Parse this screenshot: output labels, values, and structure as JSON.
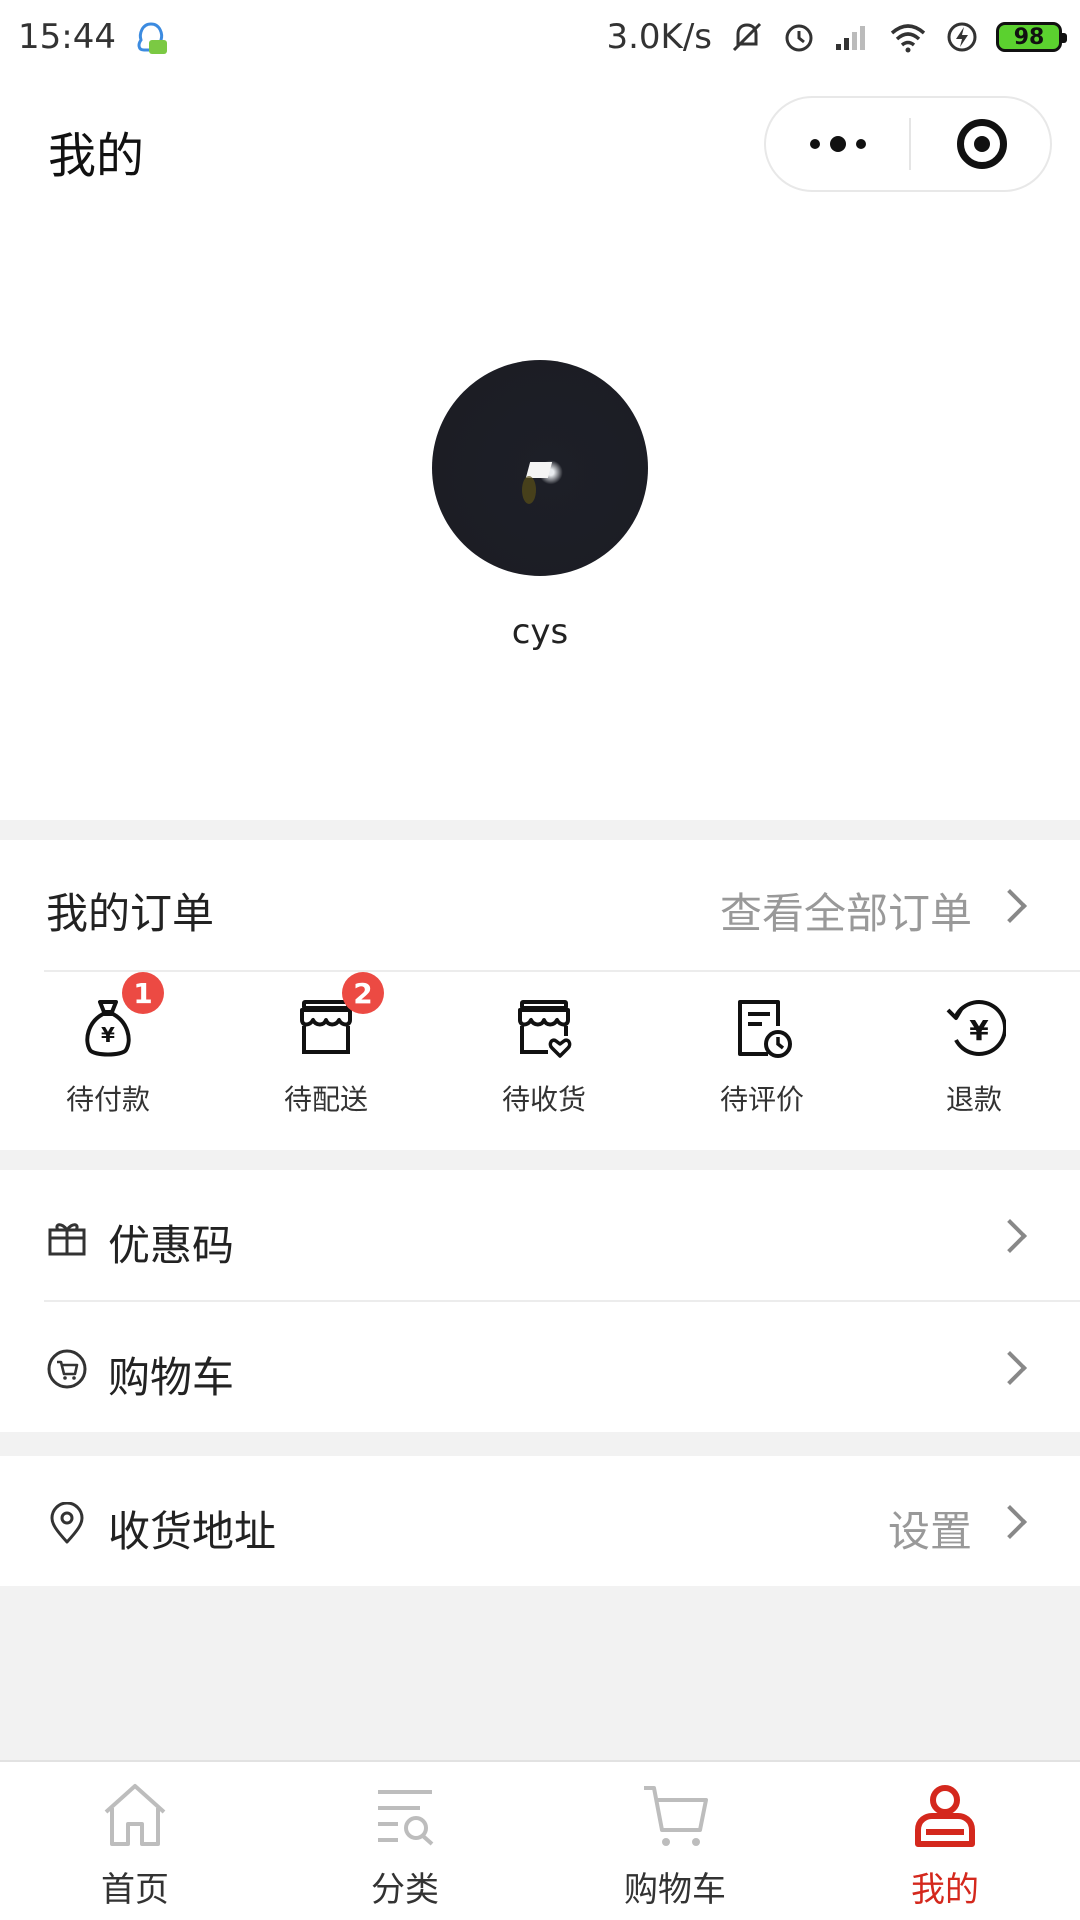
{
  "status_bar": {
    "time": "15:44",
    "network_speed": "3.0K/s",
    "battery": "98"
  },
  "nav": {
    "title": "我的"
  },
  "profile": {
    "username": "cys"
  },
  "orders": {
    "title": "我的订单",
    "view_all": "查看全部订单",
    "items": [
      {
        "label": "待付款",
        "badge": "1"
      },
      {
        "label": "待配送",
        "badge": "2"
      },
      {
        "label": "待收货",
        "badge": ""
      },
      {
        "label": "待评价",
        "badge": ""
      },
      {
        "label": "退款",
        "badge": ""
      }
    ]
  },
  "menu": {
    "coupon_label": "优惠码",
    "cart_label": "购物车",
    "address_label": "收货地址",
    "address_value": "设置"
  },
  "tabbar": {
    "tabs": [
      {
        "label": "首页"
      },
      {
        "label": "分类"
      },
      {
        "label": "购物车"
      },
      {
        "label": "我的"
      }
    ],
    "active_color": "#d4281d"
  }
}
